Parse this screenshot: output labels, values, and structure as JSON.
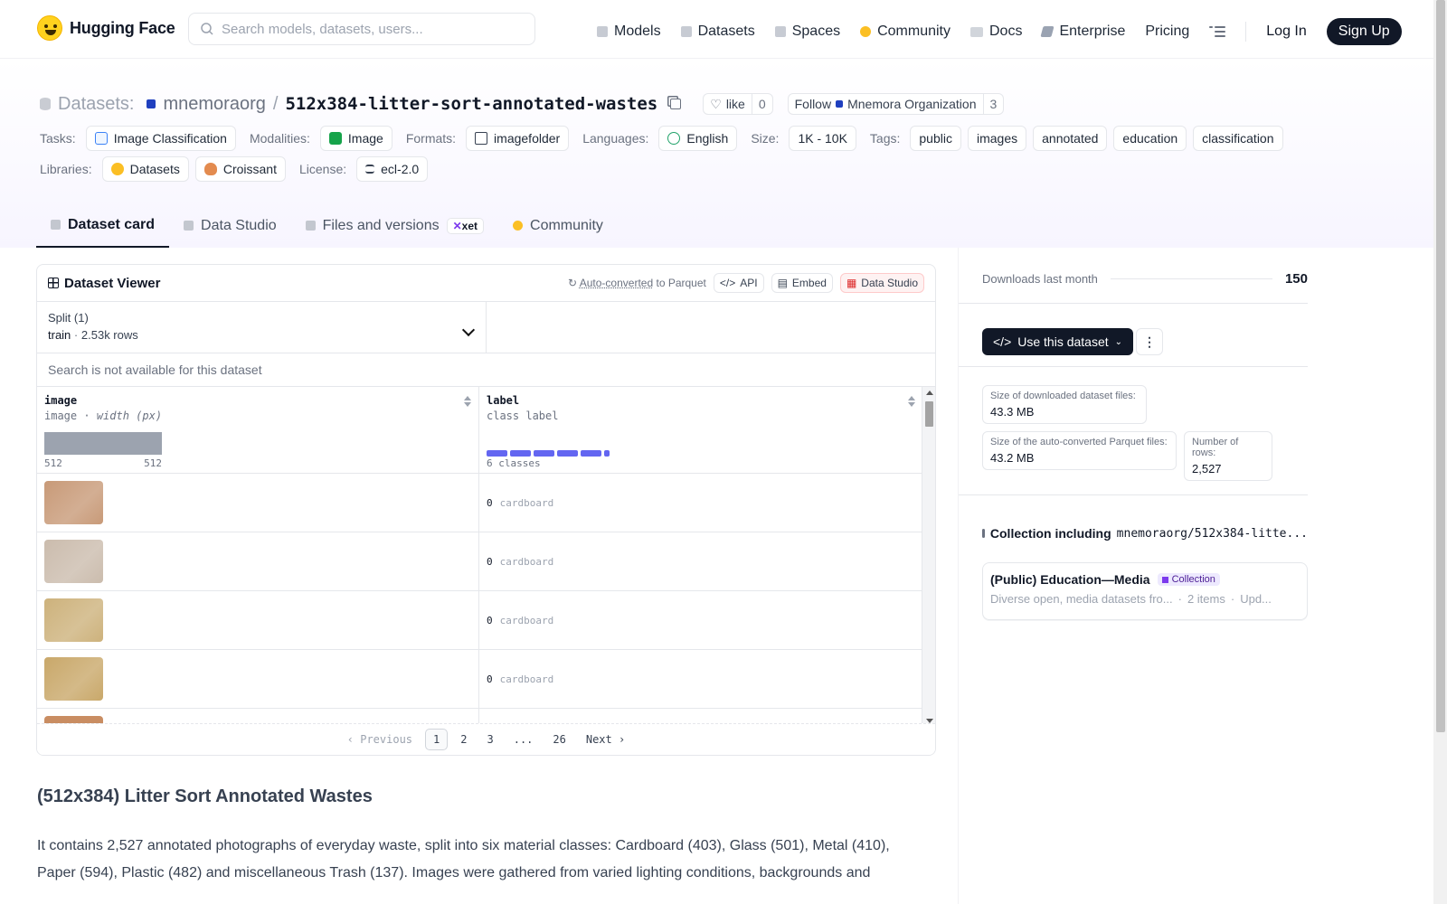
{
  "nav": {
    "brand": "Hugging Face",
    "search_placeholder": "Search models, datasets, users...",
    "links": [
      "Models",
      "Datasets",
      "Spaces",
      "Community",
      "Docs",
      "Enterprise",
      "Pricing"
    ],
    "login": "Log In",
    "signup": "Sign Up"
  },
  "repo": {
    "prefix": "Datasets:",
    "org": "mnemoraorg",
    "slash": "/",
    "name": "512x384-litter-sort-annotated-wastes",
    "like_label": "like",
    "like_count": "0",
    "follow_label": "Follow",
    "follow_org": "Mnemora Organization",
    "follow_count": "3"
  },
  "tags": {
    "tasks_label": "Tasks:",
    "tasks": "Image Classification",
    "modalities_label": "Modalities:",
    "modalities": "Image",
    "formats_label": "Formats:",
    "formats": "imagefolder",
    "languages_label": "Languages:",
    "languages": "English",
    "size_label": "Size:",
    "size": "1K - 10K",
    "tags_label": "Tags:",
    "tag_list": [
      "public",
      "images",
      "annotated",
      "education",
      "classification"
    ],
    "libraries_label": "Libraries:",
    "libraries": [
      "Datasets",
      "Croissant"
    ],
    "license_label": "License:",
    "license": "ecl-2.0"
  },
  "tabs": [
    "Dataset card",
    "Data Studio",
    "Files and versions",
    "Community"
  ],
  "xet_badge": "xet",
  "viewer": {
    "title": "Dataset Viewer",
    "autoconv_link": "Auto-converted",
    "autoconv_rest": "to Parquet",
    "api": "API",
    "embed": "Embed",
    "data_studio": "Data Studio",
    "split_label": "Split (1)",
    "split_name": "train",
    "split_sep": "·",
    "split_rows": "2.53k rows",
    "search_na": "Search is not available for this dataset",
    "col1_name": "image",
    "col1_type": "image",
    "col1_sep": "·",
    "col1_sub": "width (px)",
    "col1_min": "512",
    "col1_max": "512",
    "col2_name": "label",
    "col2_type": "class label",
    "col2_classes": "6 classes",
    "rows": [
      {
        "label_id": "0",
        "label": "cardboard",
        "color": "#c89a78"
      },
      {
        "label_id": "0",
        "label": "cardboard",
        "color": "#cbbcad"
      },
      {
        "label_id": "0",
        "label": "cardboard",
        "color": "#cdb27c"
      },
      {
        "label_id": "0",
        "label": "cardboard",
        "color": "#c9a86a"
      }
    ],
    "partial_row_color": "#c98d62",
    "pager": {
      "prev": "Previous",
      "pages": [
        "1",
        "2",
        "3",
        "...",
        "26"
      ],
      "next": "Next"
    }
  },
  "readme": {
    "title": "(512x384) Litter Sort Annotated Wastes",
    "body": "It contains 2,527 annotated photographs of everyday waste, split into six material classes: Cardboard (403), Glass (501), Metal (410), Paper (594), Plastic (482) and miscellaneous Trash (137). Images were gathered from varied lighting conditions, backgrounds and"
  },
  "sidebar": {
    "downloads_label": "Downloads last month",
    "downloads_value": "150",
    "use_btn": "Use this dataset",
    "size_dl_label": "Size of downloaded dataset files:",
    "size_dl_value": "43.3 MB",
    "size_pq_label": "Size of the auto-converted Parquet files:",
    "size_pq_value": "43.2 MB",
    "rows_label": "Number of rows:",
    "rows_value": "2,527",
    "collection_prefix": "Collection including",
    "collection_repo": "mnemoraorg/512x384-litte...",
    "collection_title": "(Public) Education—Media",
    "collection_badge": "Collection",
    "collection_desc": "Diverse open, media datasets fro...",
    "collection_items": "2 items",
    "collection_updated": "Upd..."
  }
}
